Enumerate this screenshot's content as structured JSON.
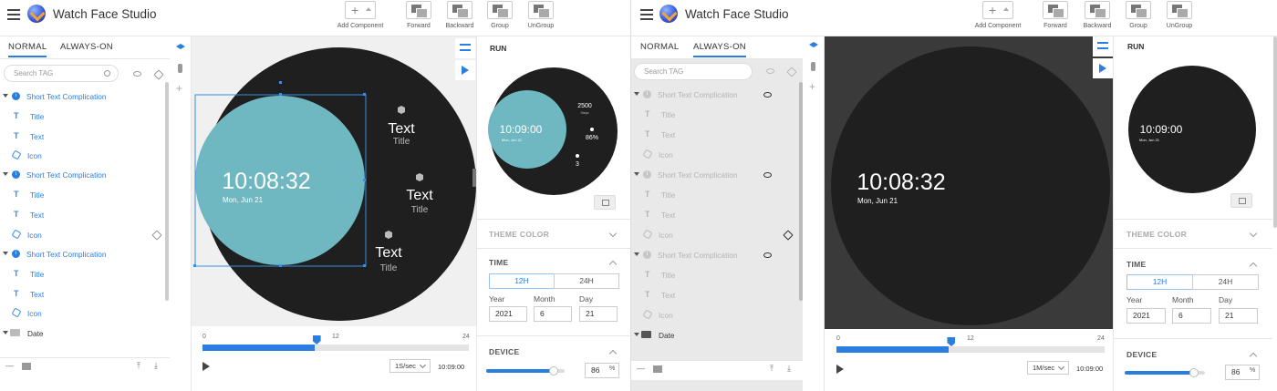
{
  "app_title": "Watch Face Studio",
  "toolbar": {
    "add_component": "Add Component",
    "forward": "Forward",
    "backward": "Backward",
    "group": "Group",
    "ungroup": "UnGroup"
  },
  "mode_tabs": [
    "NORMAL",
    "ALWAYS-ON"
  ],
  "search_placeholder": "Search TAG",
  "layers": [
    {
      "label": "Short Text Complication",
      "children": [
        "Title",
        "Text",
        "Icon"
      ]
    },
    {
      "label": "Short Text Complication",
      "children": [
        "Title",
        "Text",
        "Icon"
      ]
    },
    {
      "label": "Short Text Complication",
      "children": [
        "Title",
        "Text",
        "Icon"
      ]
    }
  ],
  "date_group": "Date",
  "canvas_normal": {
    "time": "10:08:32",
    "date": "Mon, Jun 21",
    "complications": [
      {
        "text": "Text",
        "title": "Title"
      },
      {
        "text": "Text",
        "title": "Title"
      },
      {
        "text": "Text",
        "title": "Title"
      }
    ]
  },
  "canvas_aod": {
    "time": "10:08:32",
    "date": "Mon, Jun 21"
  },
  "preview_normal": {
    "time": "10:09:00",
    "date": "Mon, Jun 21",
    "steps": "2500",
    "steps_label": "Steps",
    "battery": "86%",
    "count": "3"
  },
  "preview_aod": {
    "time": "10:09:00",
    "date": "Mon, Jun 21"
  },
  "run": {
    "title": "RUN",
    "theme_color": "THEME COLOR",
    "time_section": "TIME",
    "formats": [
      "12H",
      "24H"
    ],
    "year_label": "Year",
    "month_label": "Month",
    "day_label": "Day",
    "year": "2021",
    "month": "6",
    "day": "21",
    "device_section": "DEVICE",
    "device_level": "86",
    "device_level_fraction": 0.86,
    "percent": "%"
  },
  "timeline": {
    "ticks": [
      "0",
      "12",
      "24"
    ],
    "progress_fraction": 0.5,
    "speed_normal": "1S/sec",
    "speed_aod": "1M/sec",
    "current_time": "10:09:00"
  },
  "colors": {
    "accent": "#2a7de1",
    "face": "#1f1f1f",
    "teal": "#6fb8c1"
  }
}
